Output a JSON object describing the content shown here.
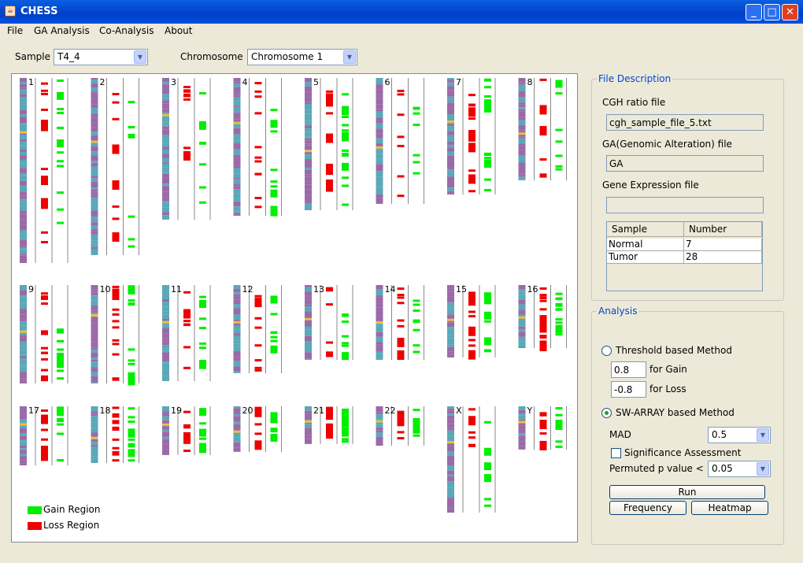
{
  "window": {
    "title": "CHESS",
    "controls": [
      "minimize",
      "maximize",
      "close"
    ]
  },
  "menu": [
    "File",
    "GA Analysis",
    "Co-Analysis",
    "About"
  ],
  "toolbar": {
    "sample_label": "Sample",
    "sample_value": "T4_4",
    "chromosome_label": "Chromosome",
    "chromosome_value": "Chromosome 1"
  },
  "colors": {
    "gain": "#00ee00",
    "loss": "#ee0000",
    "chrom_purple": "#9a6aa8",
    "chrom_teal": "#5aa8b8",
    "centromere": "#e8c040"
  },
  "chromosomes": [
    "1",
    "2",
    "3",
    "4",
    "5",
    "6",
    "7",
    "8",
    "9",
    "10",
    "11",
    "12",
    "13",
    "14",
    "15",
    "16",
    "17",
    "18",
    "19",
    "20",
    "21",
    "22",
    "X",
    "Y"
  ],
  "legend": {
    "gain": "Gain Region",
    "loss": "Loss Region"
  },
  "file_description": {
    "title": "File Description",
    "cgh_label": "CGH ratio file",
    "cgh_value": "cgh_sample_file_5.txt",
    "ga_label": "GA(Genomic Alteration) file",
    "ga_value": "GA",
    "expr_label": "Gene Expression file",
    "expr_value": "",
    "table": {
      "headers": [
        "Sample",
        "Number"
      ],
      "rows": [
        [
          "Normal",
          "7"
        ],
        [
          "Tumor",
          "28"
        ]
      ]
    }
  },
  "analysis": {
    "title": "Analysis",
    "threshold_label": "Threshold based Method",
    "gain_value": "0.8",
    "gain_label": "for Gain",
    "loss_value": "-0.8",
    "loss_label": "for Loss",
    "swarray_label": "SW-ARRAY based Method",
    "mad_label": "MAD",
    "mad_value": "0.5",
    "sig_label": "Significance Assessment",
    "perm_label": "Permuted p value <",
    "perm_value": "0.05",
    "run": "Run",
    "frequency": "Frequency",
    "heatmap": "Heatmap"
  }
}
